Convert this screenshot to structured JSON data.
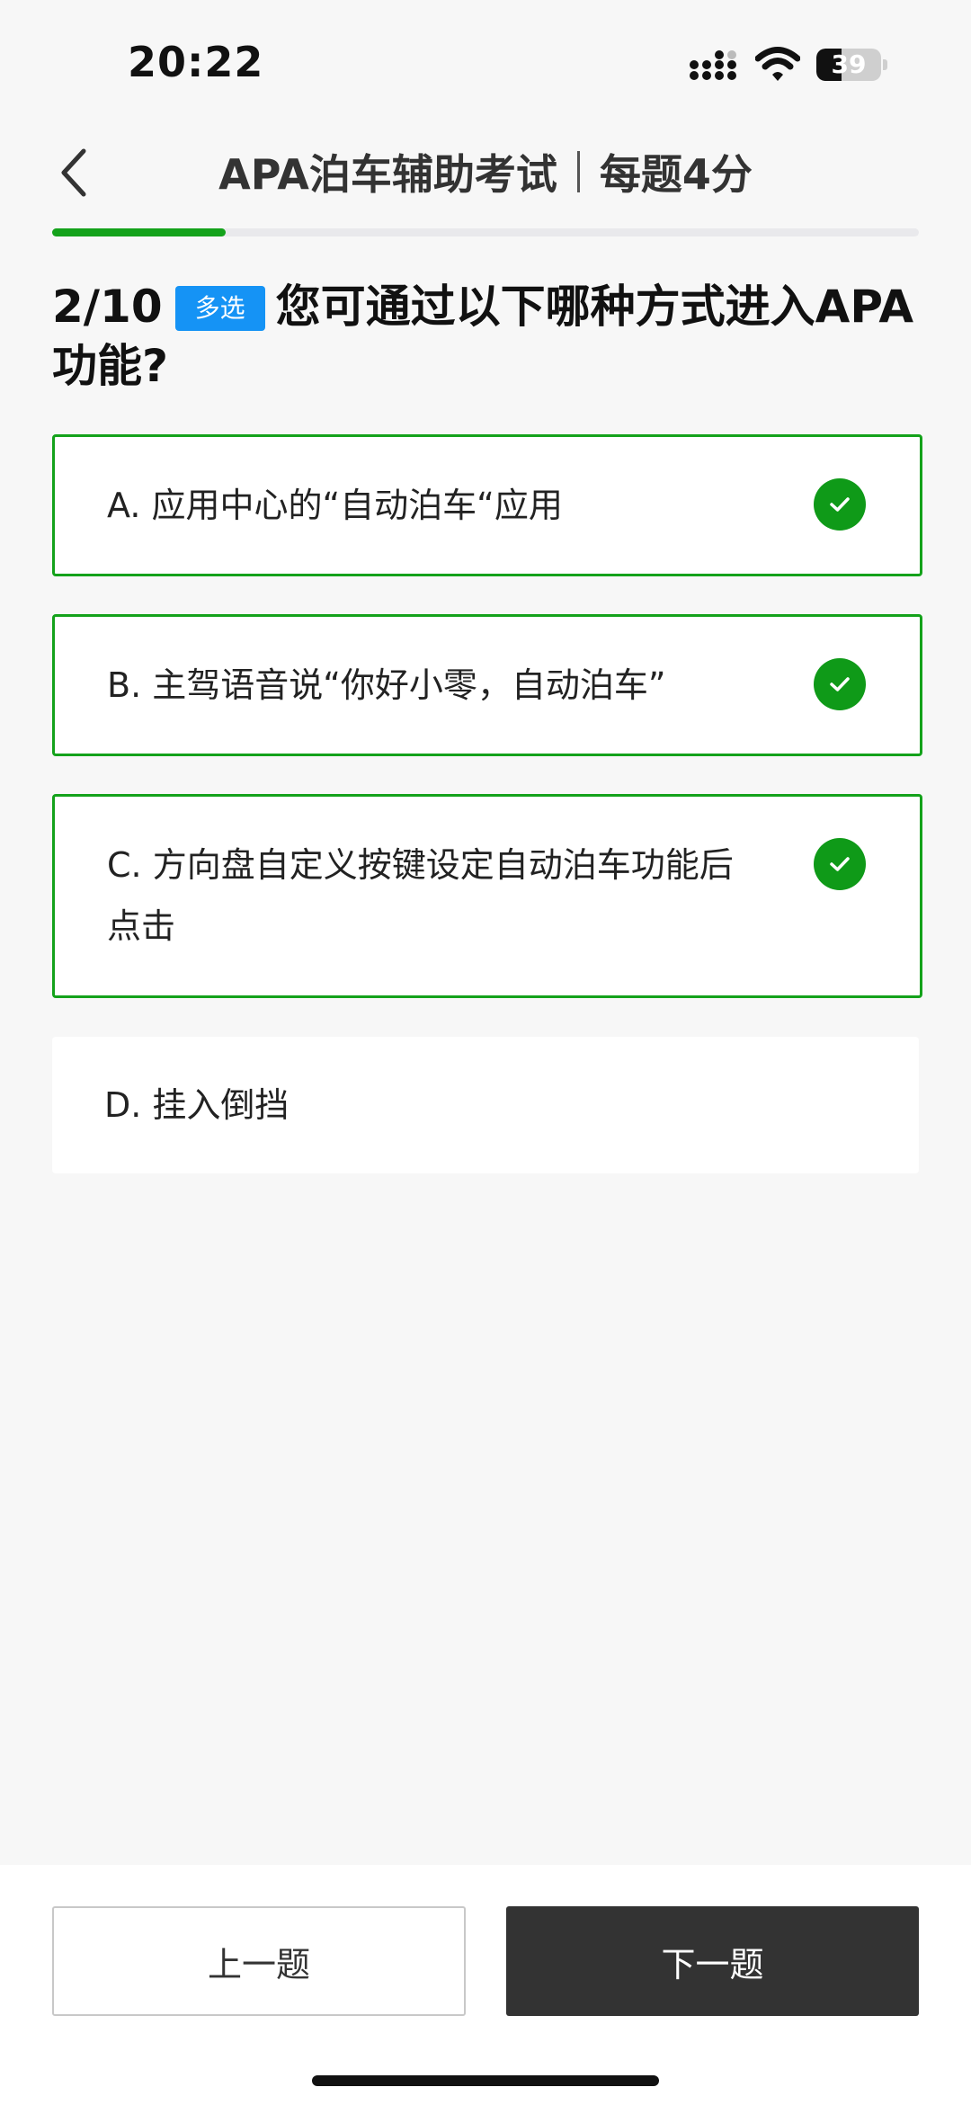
{
  "status_bar": {
    "time": "20:22",
    "battery": "39",
    "battery_level": 0.39
  },
  "header": {
    "title": "APA泊车辅助考试",
    "subtitle": "每题4分"
  },
  "progress": {
    "current": 2,
    "total": 10,
    "fraction": 0.2
  },
  "question": {
    "number": "2/10",
    "type_badge": "多选",
    "text": "您可通过以下哪种方式进入APA功能?"
  },
  "options": [
    {
      "label": "A. 应用中心的“自动泊车“应用",
      "selected": true
    },
    {
      "label": "B. 主驾语音说“你好小零，自动泊车”",
      "selected": true
    },
    {
      "label": "C. 方向盘自定义按键设定自动泊车功能后点击",
      "selected": true
    },
    {
      "label": "D. 挂入倒挡",
      "selected": false
    }
  ],
  "buttons": {
    "prev": "上一题",
    "next": "下一题"
  },
  "colors": {
    "accent_green": "#14a21b",
    "badge_blue": "#1593f5",
    "next_button": "#333333"
  },
  "icons": {
    "back": "chevron-left-icon",
    "check": "check-circle-icon"
  }
}
